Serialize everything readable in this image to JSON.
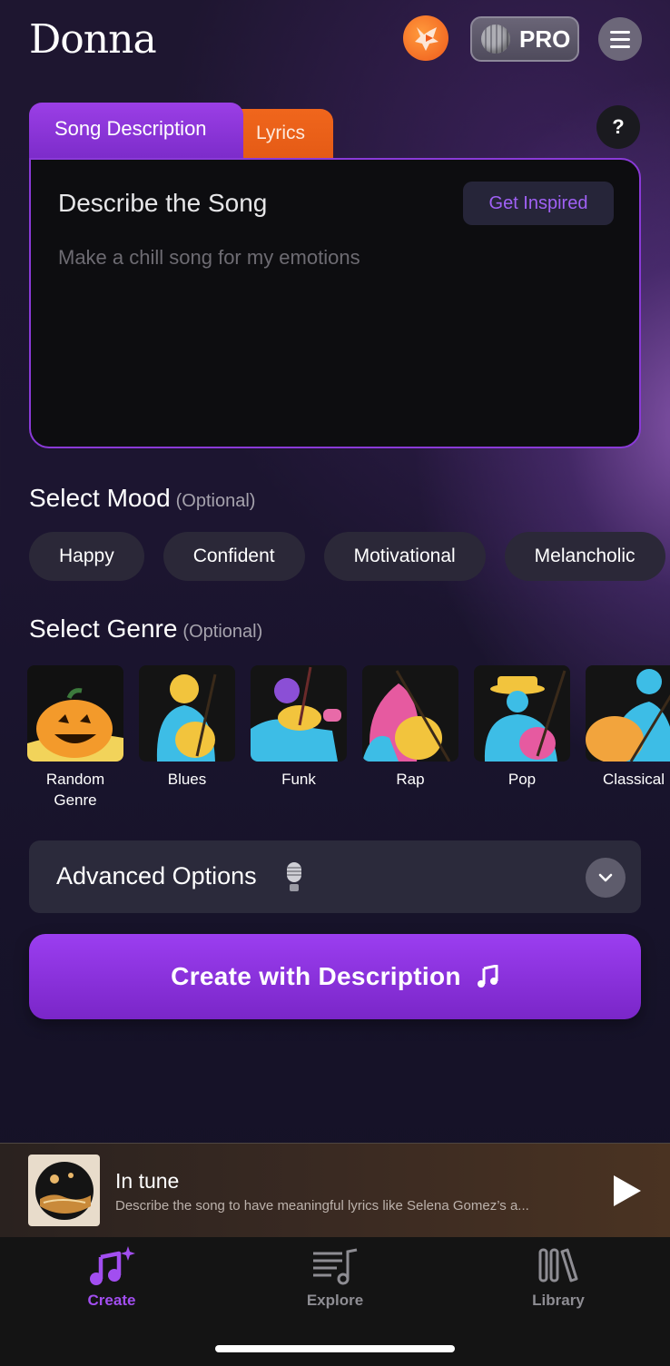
{
  "header": {
    "logo": "Donna",
    "pro_label": "PRO"
  },
  "tabs": [
    {
      "label": "Song Description",
      "active": true
    },
    {
      "label": "Lyrics",
      "active": false
    }
  ],
  "help_label": "?",
  "description": {
    "title": "Describe the Song",
    "inspire_label": "Get Inspired",
    "placeholder": "Make a chill song for my emotions"
  },
  "mood": {
    "title": "Select Mood",
    "optional": "(Optional)",
    "options": [
      "Happy",
      "Confident",
      "Motivational",
      "Melancholic"
    ]
  },
  "genre": {
    "title": "Select Genre",
    "optional": "(Optional)",
    "options": [
      "Random Genre",
      "Blues",
      "Funk",
      "Rap",
      "Pop",
      "Classical"
    ]
  },
  "advanced": {
    "label": "Advanced Options"
  },
  "create_button": {
    "label": "Create with Description"
  },
  "player": {
    "title": "In tune",
    "subtitle": "Describe the song to have meaningful lyrics like Selena Gomez’s a..."
  },
  "nav": {
    "items": [
      {
        "label": "Create",
        "active": true
      },
      {
        "label": "Explore",
        "active": false
      },
      {
        "label": "Library",
        "active": false
      }
    ]
  },
  "colors": {
    "accent": "#9b3fe6",
    "lyrics_tab": "#f0661c",
    "nav_active": "#a24ef0",
    "nav_inactive": "#8e8d93"
  }
}
